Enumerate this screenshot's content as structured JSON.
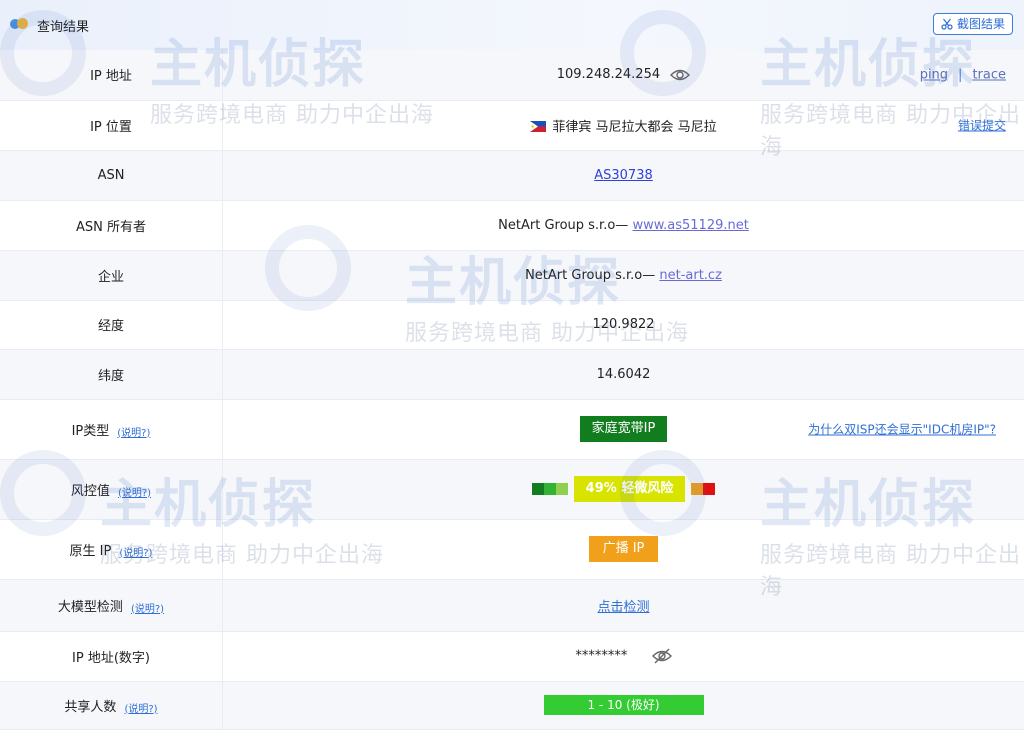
{
  "header": {
    "title": "查询结果",
    "screenshot_button": "截图结果"
  },
  "rows": {
    "ip": {
      "label": "IP 地址",
      "value": "109.248.24.254",
      "links": [
        "ping",
        "trace"
      ],
      "separator": "|"
    },
    "location": {
      "label": "IP 位置",
      "value": "菲律宾 马尼拉大都会 马尼拉",
      "flag": "philippines-flag",
      "link": "错误提交"
    },
    "asn": {
      "label": "ASN",
      "value": "AS30738"
    },
    "asn_owner": {
      "label": "ASN 所有者",
      "value": "NetArt Group s.r.o— ",
      "link": "www.as51129.net"
    },
    "company": {
      "label": "企业",
      "value": "NetArt Group s.r.o— ",
      "link": "net-art.cz"
    },
    "longitude": {
      "label": "经度",
      "value": "120.9822"
    },
    "latitude": {
      "label": "纬度",
      "value": "14.6042"
    },
    "ip_type": {
      "label": "IP类型",
      "help": "(说明?)",
      "badge": "家庭宽带IP",
      "link": "为什么双ISP还会显示\"IDC机房IP\"?"
    },
    "risk": {
      "label": "风控值",
      "help": "(说明?)",
      "score": 0.49,
      "text": "49%  轻微风险",
      "colors": [
        "#127d1f",
        "#33b233",
        "#8fd14f",
        "#f0a01a",
        "#e01010"
      ]
    },
    "native": {
      "label": "原生 IP",
      "help": "(说明?)",
      "badge": "广播 IP"
    },
    "ai_detect": {
      "label": "大模型检测",
      "help": "(说明?)",
      "link": "点击检测"
    },
    "ip_numeric": {
      "label": "IP 地址(数字)",
      "value": "********"
    },
    "shared": {
      "label": "共享人数",
      "help": "(说明?)",
      "badge": "1 - 10 (极好)"
    }
  },
  "watermark": {
    "brand": "主机侦探",
    "slogan": "服务跨境电商  助力中企出海"
  },
  "colors": {
    "accent": "#2f6fd6",
    "green_badge": "#127d1f",
    "orange_badge": "#f0a01a",
    "lime_badge": "#33cc33",
    "risk_mid": "#d8e400"
  }
}
